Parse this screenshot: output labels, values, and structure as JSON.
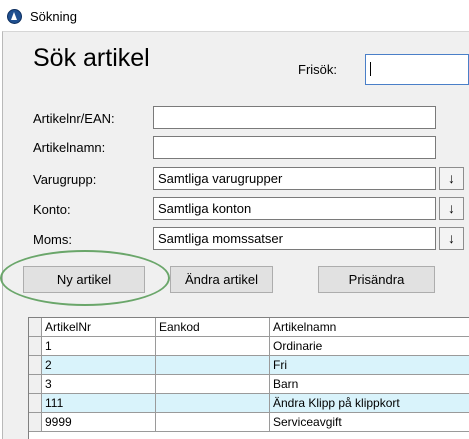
{
  "window": {
    "title": "Sökning",
    "icon": "app-logo-icon"
  },
  "header": {
    "title": "Sök artikel"
  },
  "freesearch": {
    "label": "Frisök:",
    "value": ""
  },
  "fields": {
    "artnr": {
      "label": "Artikelnr/EAN:",
      "value": ""
    },
    "name": {
      "label": "Artikelnamn:",
      "value": ""
    },
    "group": {
      "label": "Varugrupp:",
      "value": "Samtliga varugrupper"
    },
    "account": {
      "label": "Konto:",
      "value": "Samtliga konton"
    },
    "vat": {
      "label": "Moms:",
      "value": "Samtliga momssatser"
    },
    "dropdown_glyph": "↓"
  },
  "buttons": {
    "new": "Ny artikel",
    "edit": "Ändra artikel",
    "price": "Prisändra"
  },
  "grid": {
    "columns": [
      "ArtikelNr",
      "Eankod",
      "Artikelnamn"
    ],
    "rows": [
      {
        "nr": "1",
        "ean": "",
        "name": "Ordinarie"
      },
      {
        "nr": "2",
        "ean": "",
        "name": "Fri"
      },
      {
        "nr": "3",
        "ean": "",
        "name": "Barn"
      },
      {
        "nr": "111",
        "ean": "",
        "name": "Ändra Klipp på klippkort"
      },
      {
        "nr": "9999",
        "ean": "",
        "name": "Serviceavgift"
      }
    ]
  },
  "colors": {
    "row_alt": "#d9f3fb",
    "highlight_ring": "#6aa66a",
    "window_bg": "#f0f0f0"
  }
}
